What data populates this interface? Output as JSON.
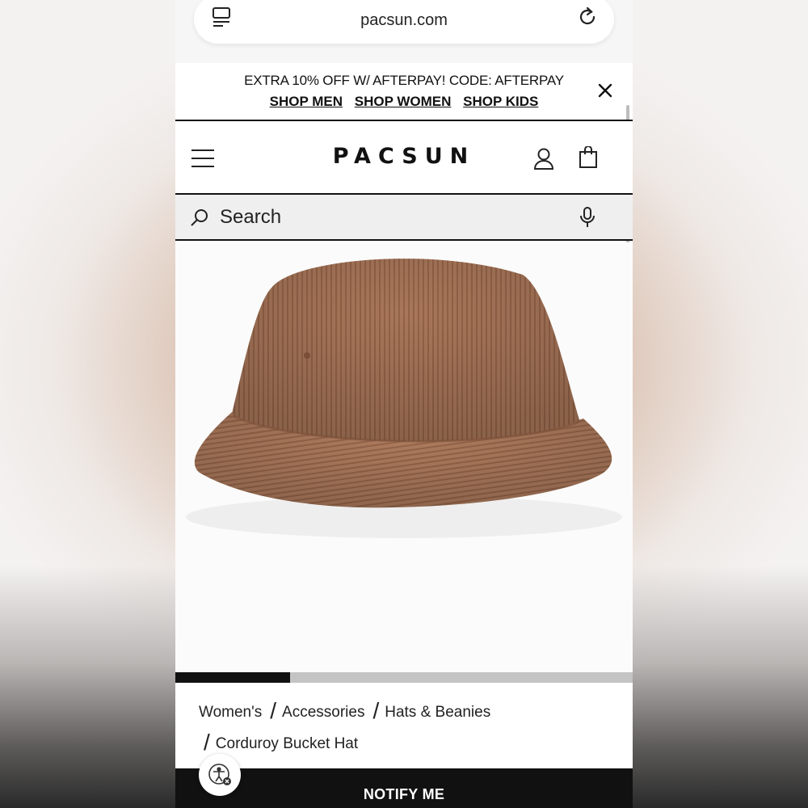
{
  "browser": {
    "url": "pacsun.com",
    "tabs_icon": "tabs-icon",
    "reload_icon": "reload-icon"
  },
  "promo": {
    "text": "EXTRA 10% OFF W/ AFTERPAY! CODE: AFTERPAY",
    "links": [
      "SHOP MEN",
      "SHOP WOMEN",
      "SHOP KIDS"
    ],
    "close_icon": "close-icon"
  },
  "header": {
    "logo": "PACSUN",
    "icons": [
      "menu-icon",
      "account-icon",
      "shopping-bag-icon"
    ]
  },
  "search": {
    "placeholder": "Search",
    "icons": [
      "search-icon",
      "microphone-icon"
    ]
  },
  "product": {
    "image_subject": "brown corduroy bucket hat",
    "image_count_progress": 0.25
  },
  "breadcrumb": {
    "items": [
      "Women's",
      "Accessories",
      "Hats & Beanies",
      "Corduroy Bucket Hat"
    ],
    "separator": "/"
  },
  "cta": {
    "label": "NOTIFY ME"
  },
  "colors": {
    "primary": "#111111",
    "hat": "#a9775a"
  }
}
